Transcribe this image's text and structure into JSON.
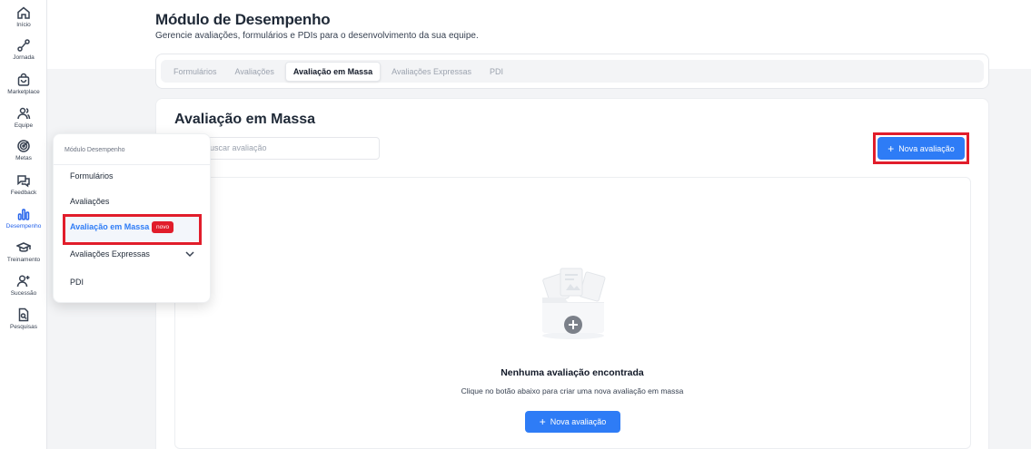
{
  "sidebar": {
    "items": [
      {
        "label": "Início",
        "icon": "home-icon"
      },
      {
        "label": "Jornada",
        "icon": "journey-icon"
      },
      {
        "label": "Marketplace",
        "icon": "shopping-bag-icon"
      },
      {
        "label": "Equipe",
        "icon": "users-icon"
      },
      {
        "label": "Metas",
        "icon": "target-icon"
      },
      {
        "label": "Feedback",
        "icon": "chat-bubbles-icon"
      },
      {
        "label": "Desempenho",
        "icon": "bar-chart-icon",
        "active": true
      },
      {
        "label": "Treinamento",
        "icon": "graduation-cap-icon"
      },
      {
        "label": "Sucessão",
        "icon": "user-plus-icon"
      },
      {
        "label": "Pesquisas",
        "icon": "survey-document-icon"
      }
    ]
  },
  "header": {
    "title": "Módulo de Desempenho",
    "subtitle": "Gerencie avaliações, formulários e PDIs para o desenvolvimento da sua equipe."
  },
  "tabs": [
    {
      "label": "Formulários"
    },
    {
      "label": "Avaliações"
    },
    {
      "label": "Avaliação em Massa",
      "active": true
    },
    {
      "label": "Avaliações Expressas"
    },
    {
      "label": "PDI"
    }
  ],
  "main": {
    "section_title": "Avaliação em Massa",
    "search_value": "",
    "search_placeholder": "Buscar avaliação",
    "new_button_label": "Nova avaliação",
    "empty_state": {
      "title": "Nenhuma avaliação encontrada",
      "subtitle": "Clique no botão abaixo para criar uma nova avaliação em massa",
      "button_label": "Nova avaliação"
    }
  },
  "flyout": {
    "header": "Módulo Desempenho",
    "items": [
      {
        "label": "Formulários"
      },
      {
        "label": "Avaliações"
      },
      {
        "label": "Avaliação em Massa",
        "active": true,
        "badge": "novo"
      },
      {
        "label": "Avaliações Expressas",
        "has_submenu": true
      },
      {
        "label": "PDI"
      }
    ]
  },
  "colors": {
    "accent": "#2e7cf6",
    "highlight_outline": "#e11d2b",
    "badge": "#e11d2b"
  }
}
